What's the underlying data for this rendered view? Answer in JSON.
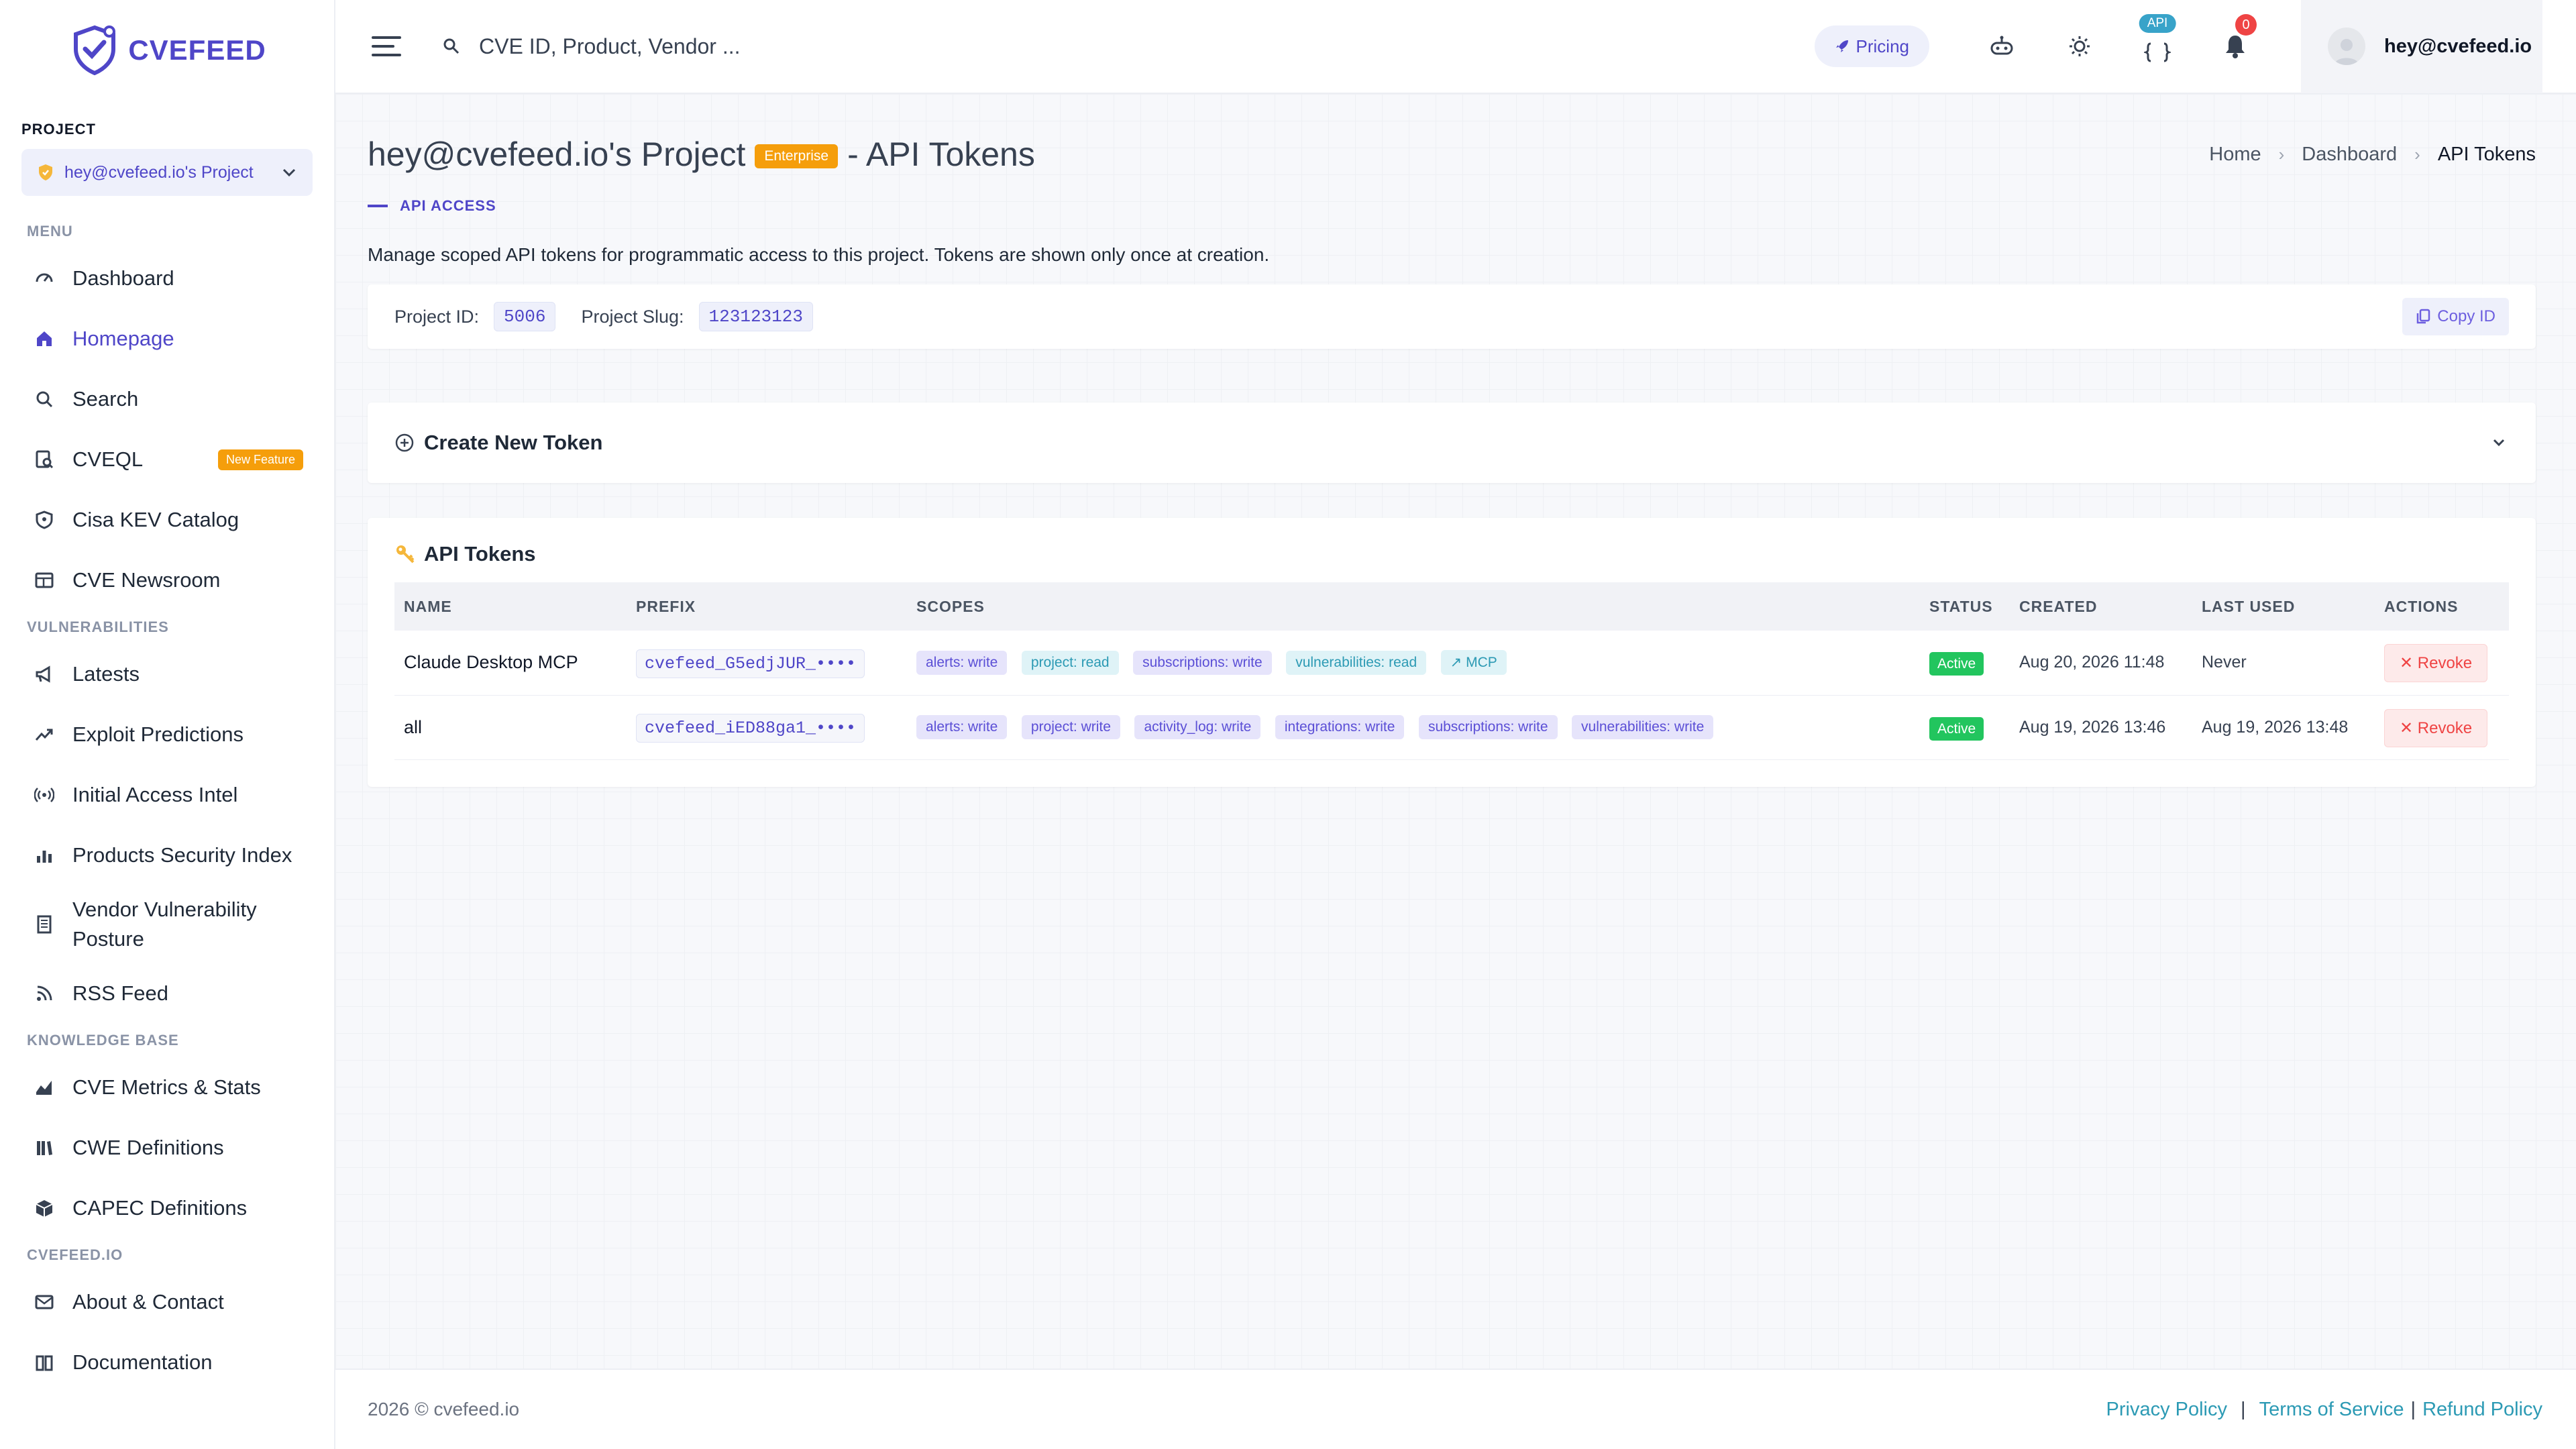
{
  "brand": {
    "name": "CVEFEED",
    "accent": "#4f46c8"
  },
  "sidebar": {
    "project_label": "PROJECT",
    "project_name": "hey@cvefeed.io's Project",
    "sections": [
      {
        "title": "MENU",
        "items": [
          {
            "label": "Dashboard",
            "icon": "dashboard-icon"
          },
          {
            "label": "Homepage",
            "icon": "home-icon",
            "active": true
          },
          {
            "label": "Search",
            "icon": "search-icon"
          },
          {
            "label": "CVEQL",
            "icon": "query-icon",
            "badge": "New Feature"
          },
          {
            "label": "Cisa KEV Catalog",
            "icon": "shield-icon"
          },
          {
            "label": "CVE Newsroom",
            "icon": "newspaper-icon"
          }
        ]
      },
      {
        "title": "VULNERABILITIES",
        "items": [
          {
            "label": "Latests",
            "icon": "megaphone-icon"
          },
          {
            "label": "Exploit Predictions",
            "icon": "trend-icon"
          },
          {
            "label": "Initial Access Intel",
            "icon": "broadcast-icon"
          },
          {
            "label": "Products Security Index",
            "icon": "bar-chart-icon"
          },
          {
            "label": "Vendor Vulnerability Posture",
            "icon": "building-icon"
          },
          {
            "label": "RSS Feed",
            "icon": "rss-icon"
          }
        ]
      },
      {
        "title": "KNOWLEDGE BASE",
        "items": [
          {
            "label": "CVE Metrics & Stats",
            "icon": "area-chart-icon"
          },
          {
            "label": "CWE Definitions",
            "icon": "library-icon"
          },
          {
            "label": "CAPEC Definitions",
            "icon": "box-icon"
          }
        ]
      },
      {
        "title": "CVEFEED.IO",
        "items": [
          {
            "label": "About & Contact",
            "icon": "mail-icon"
          },
          {
            "label": "Documentation",
            "icon": "book-icon"
          }
        ]
      }
    ]
  },
  "header": {
    "search_placeholder": "CVE ID, Product, Vendor ...",
    "pricing_label": "Pricing",
    "api_badge": "API",
    "notification_count": "0",
    "user_email": "hey@cvefeed.io"
  },
  "page": {
    "title": "hey@cvefeed.io's Project",
    "plan_badge": "Enterprise",
    "title_suffix": "- API Tokens",
    "breadcrumb": [
      "Home",
      "Dashboard",
      "API Tokens"
    ],
    "section_label": "API ACCESS",
    "description": "Manage scoped API tokens for programmatic access to this project. Tokens are shown only once at creation.",
    "project_id_label": "Project ID:",
    "project_id": "5006",
    "project_slug_label": "Project Slug:",
    "project_slug": "123123123",
    "copy_id_label": "Copy ID",
    "create_token_label": "Create New Token",
    "tokens_title": "API Tokens",
    "columns": [
      "NAME",
      "PREFIX",
      "SCOPES",
      "STATUS",
      "CREATED",
      "LAST USED",
      "ACTIONS"
    ],
    "tokens": [
      {
        "name": "Claude Desktop MCP",
        "prefix": "cvefeed_G5edjJUR_••••",
        "scopes": [
          {
            "label": "alerts: write",
            "kind": "write"
          },
          {
            "label": "project: read",
            "kind": "read"
          },
          {
            "label": "subscriptions: write",
            "kind": "write"
          },
          {
            "label": "vulnerabilities: read",
            "kind": "read"
          },
          {
            "label": "↗ MCP",
            "kind": "read"
          }
        ],
        "status": "Active",
        "created": "Aug 20, 2026 11:48",
        "last_used": "Never",
        "action": "Revoke"
      },
      {
        "name": "all",
        "prefix": "cvefeed_iED88ga1_••••",
        "scopes": [
          {
            "label": "alerts: write",
            "kind": "write"
          },
          {
            "label": "project: write",
            "kind": "write"
          },
          {
            "label": "activity_log: write",
            "kind": "write"
          },
          {
            "label": "integrations: write",
            "kind": "write"
          },
          {
            "label": "subscriptions: write",
            "kind": "write"
          },
          {
            "label": "vulnerabilities: write",
            "kind": "write"
          }
        ],
        "status": "Active",
        "created": "Aug 19, 2026 13:46",
        "last_used": "Aug 19, 2026 13:48",
        "action": "Revoke"
      }
    ]
  },
  "footer": {
    "copyright": "2026 © cvefeed.io",
    "links": [
      "Privacy Policy",
      "Terms of Service",
      "Refund Policy"
    ],
    "separator": "|"
  }
}
